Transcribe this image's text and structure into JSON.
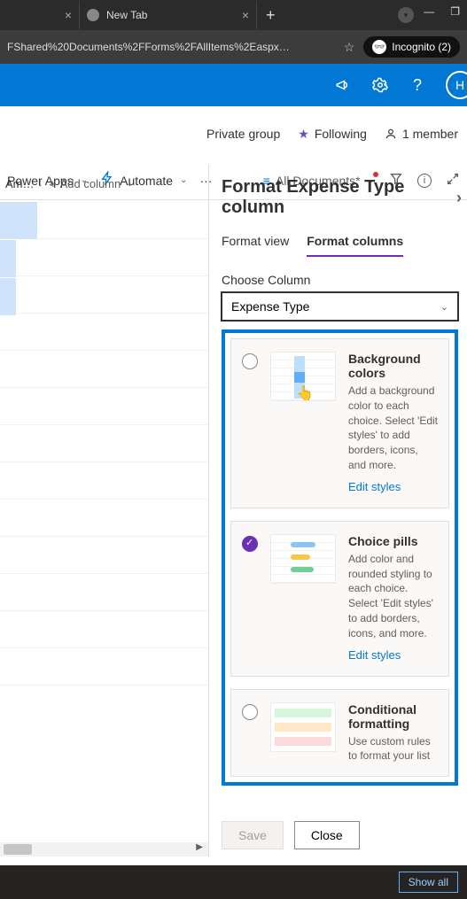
{
  "browser": {
    "tab1_close": "×",
    "tab2_label": "New Tab",
    "tab2_close": "×",
    "new_tab": "+",
    "address": "FShared%20Documents%2FForms%2FAllItems%2Easpx…",
    "incognito_label": "Incognito (2)",
    "min": "—",
    "max": "❐",
    "profile_glyph": "▾"
  },
  "suite": {
    "avatar_initial": "H"
  },
  "group": {
    "private": "Private group",
    "following": "Following",
    "member": "1 member"
  },
  "cmdbar": {
    "powerapps": "Power Apps",
    "automate": "Automate",
    "more": "···",
    "view": "All Documents*"
  },
  "columns": {
    "partial": "Am…",
    "add": "Add column"
  },
  "panel": {
    "title": "Format Expense Type column",
    "tab_view": "Format view",
    "tab_columns": "Format columns",
    "choose_label": "Choose Column",
    "dropdown_value": "Expense Type",
    "cards": [
      {
        "title": "Background colors",
        "desc": "Add a background color to each choice. Select 'Edit styles' to add borders, icons, and more.",
        "link": "Edit styles"
      },
      {
        "title": "Choice pills",
        "desc": "Add color and rounded styling to each choice. Select 'Edit styles' to add borders, icons, and more.",
        "link": "Edit styles"
      },
      {
        "title": "Conditional formatting",
        "desc": "Use custom rules to format your list"
      }
    ],
    "save": "Save",
    "close": "Close"
  },
  "bottom": {
    "show_all": "Show all"
  }
}
